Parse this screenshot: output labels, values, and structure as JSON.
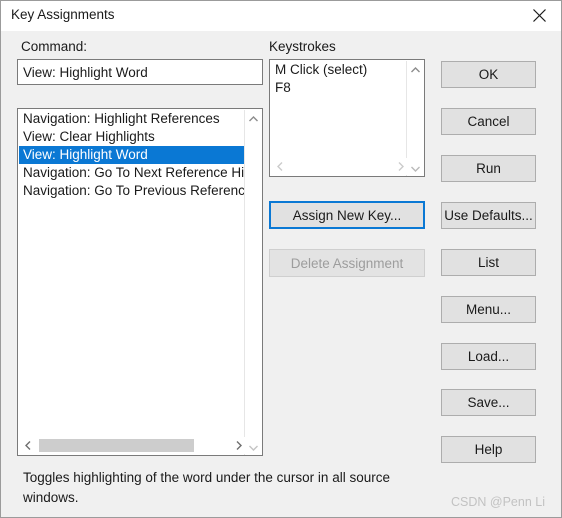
{
  "window": {
    "title": "Key Assignments",
    "close_icon": "close-icon"
  },
  "command": {
    "label": "Command:",
    "input_value": "View: Highlight Word",
    "input_placeholder": "",
    "list_items": [
      {
        "text": "Navigation: Highlight References",
        "selected": false
      },
      {
        "text": "View: Clear Highlights",
        "selected": false
      },
      {
        "text": "View: Highlight Word",
        "selected": true
      },
      {
        "text": "Navigation: Go To Next Reference Hig",
        "selected": false
      },
      {
        "text": "Navigation: Go To Previous Reference",
        "selected": false
      }
    ]
  },
  "keystrokes": {
    "label": "Keystrokes",
    "list_items": [
      {
        "text": "M Click (select)"
      },
      {
        "text": "F8"
      }
    ]
  },
  "actions": {
    "assign_new_key": "Assign New Key...",
    "delete_assignment": "Delete Assignment"
  },
  "buttons": {
    "ok": "OK",
    "cancel": "Cancel",
    "run": "Run",
    "use_defaults": "Use Defaults...",
    "list": "List",
    "menu": "Menu...",
    "load": "Load...",
    "save": "Save...",
    "help": "Help"
  },
  "description": {
    "text": "Toggles highlighting of the word under the cursor in all source windows."
  },
  "watermark": {
    "text": "CSDN @Penn Li"
  },
  "colors": {
    "selection": "#0a78d4",
    "dialog_bg": "#f0f0f0",
    "button_face": "#e1e1e1",
    "focus_border": "#0a78d4"
  }
}
